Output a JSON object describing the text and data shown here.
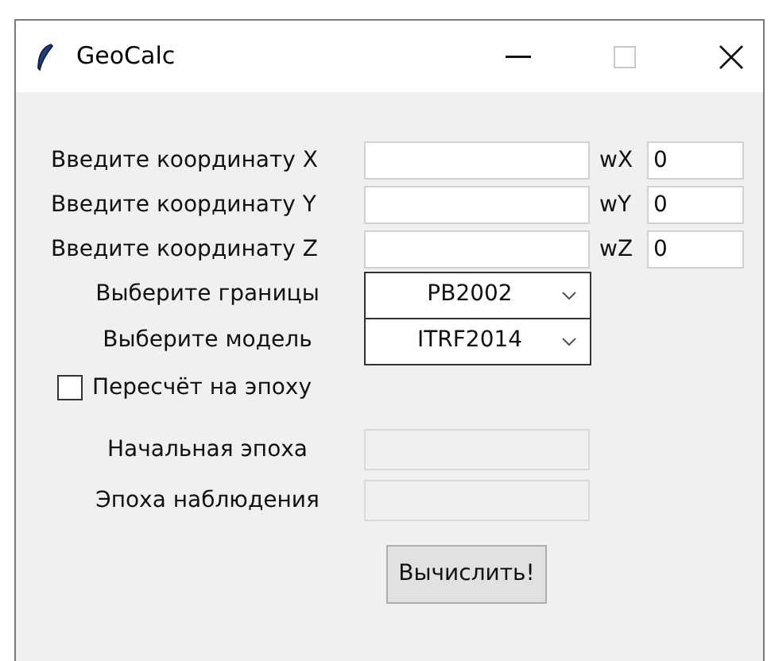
{
  "window": {
    "title": "GeoCalc"
  },
  "coordinates": [
    {
      "label": "Введите координату X",
      "weight_label": "wX",
      "weight_value": "0"
    },
    {
      "label": "Введите координату Y",
      "weight_label": "wY",
      "weight_value": "0"
    },
    {
      "label": "Введите координату Z",
      "weight_label": "wZ",
      "weight_value": "0"
    }
  ],
  "selects": [
    {
      "label": "Выберите границы",
      "value": "PB2002"
    },
    {
      "label": "Выберите модель",
      "value": "ITRF2014"
    }
  ],
  "recalc": {
    "label": "Пересчёт на эпоху",
    "checked": false
  },
  "epochs": [
    {
      "label": "Начальная эпоха",
      "disabled": true
    },
    {
      "label": "Эпоха наблюдения",
      "disabled": true
    }
  ],
  "button": "Вычислить!"
}
